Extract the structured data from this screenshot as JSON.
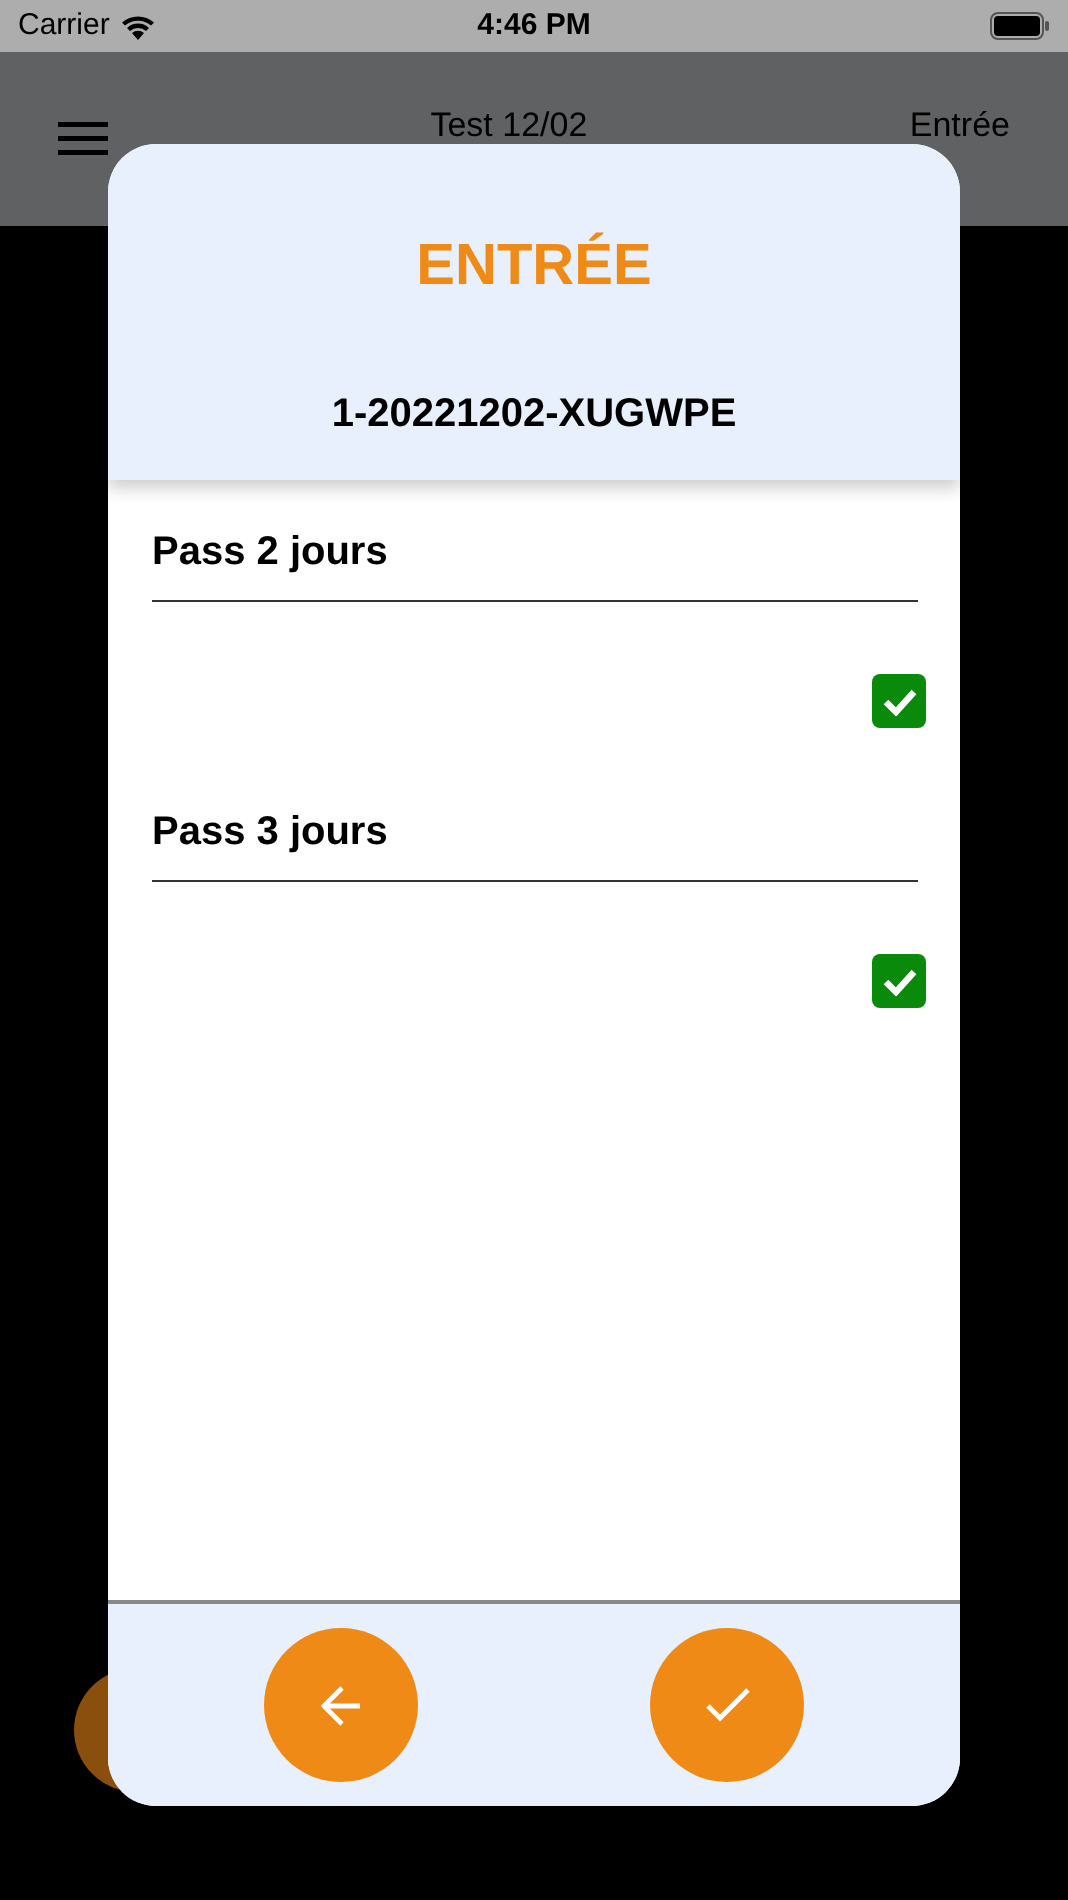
{
  "status_bar": {
    "carrier": "Carrier",
    "time": "4:46 PM"
  },
  "app_bar": {
    "title": "Test 12/02",
    "action": "Entrée"
  },
  "dialog": {
    "title": "ENTRÉE",
    "code": "1-20221202-XUGWPE",
    "items": [
      {
        "label": "Pass 2 jours",
        "checked": true
      },
      {
        "label": "Pass 3 jours",
        "checked": true
      }
    ]
  }
}
